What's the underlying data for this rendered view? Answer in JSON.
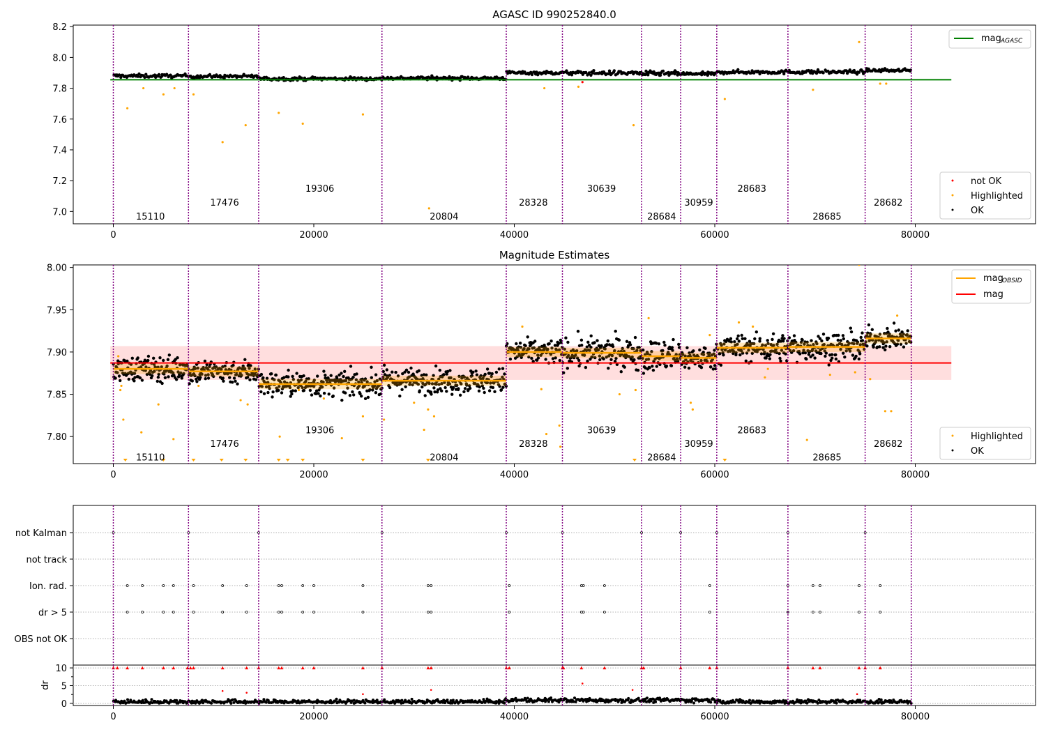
{
  "chart_data": [
    {
      "type": "scatter",
      "title": "AGASC ID 990252840.0",
      "xlim": [
        -4000,
        92000
      ],
      "ylim": [
        6.92,
        8.21
      ],
      "xticks": [
        0,
        20000,
        40000,
        60000,
        80000
      ],
      "yticks": [
        7.0,
        7.2,
        7.4,
        7.6,
        7.8,
        8.0,
        8.2
      ],
      "ytick_labels": [
        "7.0",
        "7.2",
        "7.4",
        "7.6",
        "7.8",
        "8.0",
        "8.2"
      ],
      "xtick_labels": [
        "0",
        "20000",
        "40000",
        "60000",
        "80000"
      ],
      "obs_boundaries": [
        0,
        7500,
        14500,
        26800,
        39200,
        44800,
        52700,
        56600,
        60200,
        67300,
        75000,
        79600
      ],
      "obsid_labels": [
        {
          "x": 3700,
          "y": 6.97,
          "text": "15110"
        },
        {
          "x": 11100,
          "y": 7.06,
          "text": "17476"
        },
        {
          "x": 20600,
          "y": 7.15,
          "text": "19306"
        },
        {
          "x": 33000,
          "y": 6.97,
          "text": "20804"
        },
        {
          "x": 41900,
          "y": 7.06,
          "text": "28328"
        },
        {
          "x": 48700,
          "y": 7.15,
          "text": "30639"
        },
        {
          "x": 54700,
          "y": 6.97,
          "text": "28684"
        },
        {
          "x": 58400,
          "y": 7.06,
          "text": "30959"
        },
        {
          "x": 63700,
          "y": 7.15,
          "text": "28683"
        },
        {
          "x": 71200,
          "y": 6.97,
          "text": "28685"
        },
        {
          "x": 77300,
          "y": 7.06,
          "text": "28682"
        }
      ],
      "agasc_mag": 7.855,
      "agasc_mag_xrange": [
        -300,
        83600
      ],
      "segments": [
        {
          "x0": 0,
          "x1": 7500,
          "mean": 7.88,
          "spread": 0.016
        },
        {
          "x0": 7500,
          "x1": 14500,
          "mean": 7.877,
          "spread": 0.016
        },
        {
          "x0": 14500,
          "x1": 26800,
          "mean": 7.862,
          "spread": 0.016
        },
        {
          "x0": 26800,
          "x1": 39200,
          "mean": 7.866,
          "spread": 0.016
        },
        {
          "x0": 39200,
          "x1": 44800,
          "mean": 7.9,
          "spread": 0.016
        },
        {
          "x0": 44800,
          "x1": 52700,
          "mean": 7.899,
          "spread": 0.02
        },
        {
          "x0": 52700,
          "x1": 56600,
          "mean": 7.895,
          "spread": 0.022
        },
        {
          "x0": 56600,
          "x1": 60200,
          "mean": 7.893,
          "spread": 0.016
        },
        {
          "x0": 60200,
          "x1": 67300,
          "mean": 7.905,
          "spread": 0.018
        },
        {
          "x0": 67300,
          "x1": 75000,
          "mean": 7.906,
          "spread": 0.018
        },
        {
          "x0": 75000,
          "x1": 79600,
          "mean": 7.916,
          "spread": 0.014
        }
      ],
      "highlighted_points": [
        [
          1400,
          7.67
        ],
        [
          3000,
          7.8
        ],
        [
          5000,
          7.76
        ],
        [
          6100,
          7.8
        ],
        [
          8000,
          7.76
        ],
        [
          10900,
          7.45
        ],
        [
          13200,
          7.56
        ],
        [
          16500,
          7.64
        ],
        [
          18900,
          7.57
        ],
        [
          24900,
          7.63
        ],
        [
          31500,
          7.02
        ],
        [
          43000,
          7.8
        ],
        [
          46400,
          7.81
        ],
        [
          51900,
          7.56
        ],
        [
          61000,
          7.73
        ],
        [
          69800,
          7.79
        ],
        [
          74400,
          8.1
        ],
        [
          76500,
          7.83
        ],
        [
          77100,
          7.83
        ]
      ],
      "not_ok_points": [
        [
          46800,
          7.84
        ]
      ],
      "legend_top": [
        {
          "label": "mag",
          "sub": "AGASC",
          "color": "#008000"
        }
      ],
      "legend_bottom": [
        {
          "label": "not OK",
          "color": "#ff0000"
        },
        {
          "label": "Highlighted",
          "color": "#ffa500"
        },
        {
          "label": "OK",
          "color": "#000000"
        }
      ]
    },
    {
      "type": "scatter",
      "title": "Magnitude Estimates",
      "xlim": [
        -4000,
        92000
      ],
      "ylim": [
        7.768,
        8.003
      ],
      "xticks": [
        0,
        20000,
        40000,
        60000,
        80000
      ],
      "yticks": [
        7.8,
        7.85,
        7.9,
        7.95,
        8.0
      ],
      "ytick_labels": [
        "7.80",
        "7.85",
        "7.90",
        "7.95",
        "8.00"
      ],
      "xtick_labels": [
        "0",
        "20000",
        "40000",
        "60000",
        "80000"
      ],
      "obsid_labels": [
        {
          "x": 3700,
          "y": 7.776,
          "text": "15110"
        },
        {
          "x": 11100,
          "y": 7.792,
          "text": "17476"
        },
        {
          "x": 20600,
          "y": 7.808,
          "text": "19306"
        },
        {
          "x": 33000,
          "y": 7.776,
          "text": "20804"
        },
        {
          "x": 41900,
          "y": 7.792,
          "text": "28328"
        },
        {
          "x": 48700,
          "y": 7.808,
          "text": "30639"
        },
        {
          "x": 54700,
          "y": 7.776,
          "text": "28684"
        },
        {
          "x": 58400,
          "y": 7.792,
          "text": "30959"
        },
        {
          "x": 63700,
          "y": 7.808,
          "text": "28683"
        },
        {
          "x": 71200,
          "y": 7.776,
          "text": "28685"
        },
        {
          "x": 77300,
          "y": 7.792,
          "text": "28682"
        }
      ],
      "mag": 7.887,
      "mag_band": [
        7.867,
        7.907
      ],
      "mag_xrange": [
        -300,
        83600
      ],
      "obsid_mags": [
        7.88,
        7.877,
        7.862,
        7.866,
        7.9,
        7.899,
        7.895,
        7.893,
        7.905,
        7.906,
        7.916
      ],
      "highlighted_points": [
        [
          500,
          7.895
        ],
        [
          700,
          7.855
        ],
        [
          800,
          7.86
        ],
        [
          1000,
          7.82
        ],
        [
          2800,
          7.805
        ],
        [
          4500,
          7.838
        ],
        [
          6000,
          7.797
        ],
        [
          8500,
          7.86
        ],
        [
          12700,
          7.843
        ],
        [
          13400,
          7.838
        ],
        [
          16600,
          7.8
        ],
        [
          18500,
          7.855
        ],
        [
          21000,
          7.845
        ],
        [
          22800,
          7.798
        ],
        [
          24900,
          7.824
        ],
        [
          27000,
          7.82
        ],
        [
          30000,
          7.84
        ],
        [
          31000,
          7.808
        ],
        [
          31400,
          7.832
        ],
        [
          32000,
          7.824
        ],
        [
          40800,
          7.93
        ],
        [
          42700,
          7.856
        ],
        [
          43200,
          7.803
        ],
        [
          44500,
          7.813
        ],
        [
          44600,
          7.788
        ],
        [
          50500,
          7.85
        ],
        [
          52100,
          7.855
        ],
        [
          53400,
          7.94
        ],
        [
          57600,
          7.84
        ],
        [
          57800,
          7.832
        ],
        [
          59500,
          7.92
        ],
        [
          62400,
          7.935
        ],
        [
          63800,
          7.93
        ],
        [
          65000,
          7.87
        ],
        [
          65300,
          7.88
        ],
        [
          69200,
          7.796
        ],
        [
          71500,
          7.873
        ],
        [
          74000,
          7.876
        ],
        [
          74400,
          8.003
        ],
        [
          75500,
          7.868
        ],
        [
          77000,
          7.83
        ],
        [
          77600,
          7.83
        ],
        [
          78200,
          7.943
        ]
      ],
      "lower_limits": [
        1200,
        5000,
        8000,
        10800,
        13200,
        16500,
        17400,
        18900,
        24900,
        31400,
        52000,
        61000
      ],
      "legend_top": [
        {
          "label": "mag",
          "sub": "OBSID",
          "color": "#ffa500"
        },
        {
          "label": "mag",
          "sub": "",
          "color": "#ff0000"
        }
      ],
      "legend_bottom": [
        {
          "label": "Highlighted",
          "color": "#ffa500"
        },
        {
          "label": "OK",
          "color": "#000000"
        }
      ]
    },
    {
      "type": "scatter",
      "title": "",
      "xlim": [
        -4000,
        92000
      ],
      "categories": [
        "not Kalman",
        "not track",
        "Ion. rad.",
        "dr > 5",
        "OBS not OK"
      ],
      "flag_points": {
        "not Kalman": [
          0,
          7500,
          14500,
          26800,
          39200,
          44800,
          52700,
          56600,
          60200,
          67300,
          75000
        ],
        "not track": [],
        "Ion. rad.": [
          1400,
          2900,
          5000,
          6000,
          8000,
          10900,
          13300,
          16500,
          16800,
          18900,
          20000,
          24900,
          31400,
          31700,
          39500,
          46700,
          46900,
          49000,
          59500,
          67300,
          69800,
          70500,
          74400,
          76500
        ],
        "dr > 5": [
          1400,
          2900,
          5000,
          6000,
          8000,
          10900,
          13300,
          16500,
          16800,
          18900,
          20000,
          24900,
          31400,
          31700,
          39500,
          46700,
          46900,
          49000,
          59500,
          67300,
          69800,
          70500,
          74400,
          76500
        ],
        "OBS not OK": []
      }
    },
    {
      "type": "scatter",
      "title": "",
      "ylabel": "dr",
      "xlim": [
        -4000,
        92000
      ],
      "ylim": [
        -0.6,
        10.8
      ],
      "yticks": [
        0,
        5,
        10
      ],
      "ytick_labels": [
        "0",
        "5",
        "10"
      ],
      "xticks": [
        0,
        20000,
        40000,
        60000,
        80000
      ],
      "xtick_labels": [
        "0",
        "20000",
        "40000",
        "60000",
        "80000"
      ],
      "clipped_points": [
        0,
        400,
        1400,
        2900,
        5000,
        6000,
        7400,
        7700,
        8000,
        10900,
        13300,
        14500,
        16500,
        16800,
        18900,
        20000,
        24900,
        26800,
        31400,
        31700,
        39200,
        39500,
        44800,
        44900,
        46700,
        49000,
        52700,
        52900,
        56600,
        59500,
        60200,
        67300,
        69800,
        70500,
        74400,
        75000,
        76500
      ],
      "outliers": [
        [
          10900,
          3.5
        ],
        [
          13300,
          3.0
        ],
        [
          24900,
          2.6
        ],
        [
          31700,
          3.8
        ],
        [
          46800,
          5.6
        ],
        [
          51800,
          3.8
        ],
        [
          74200,
          2.6
        ]
      ]
    }
  ]
}
